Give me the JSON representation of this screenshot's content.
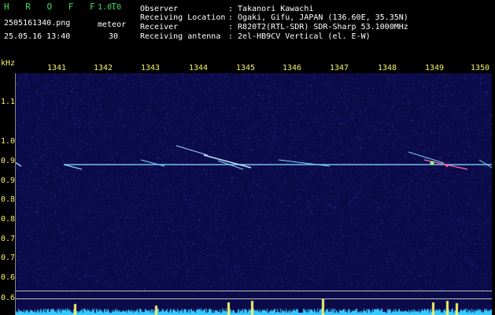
{
  "app": {
    "name": "H R O F F T",
    "version": "1.0.0"
  },
  "file": {
    "name": "2505161340.png",
    "datetime": "25.05.16 13:40"
  },
  "detection": {
    "label": "meteor",
    "count": "30"
  },
  "info": {
    "observer_label": "Observer",
    "observer_value": ": Takanori Kawachi",
    "location_label": "Receiving Location",
    "location_value": ": Ogaki, Gifu, JAPAN (136.60E, 35.35N)",
    "receiver_label": "Receiver",
    "receiver_value": ": R820T2(RTL-SDR) SDR-Sharp 53.1000MHz",
    "antenna_label": "Receiving antenna",
    "antenna_value": ": 2el-HB9CV Vertical (el. E-W)"
  },
  "axis": {
    "unit": "kHz",
    "time_ticks": [
      "1341",
      "1342",
      "1343",
      "1344",
      "1345",
      "1346",
      "1347",
      "1348",
      "1349",
      "1350"
    ],
    "freq_ticks": [
      "1.1",
      "1.0",
      "0.95",
      "0.9",
      "0.85",
      "0.8",
      "0.75",
      "0.7",
      "0.65",
      "0.6"
    ]
  },
  "colors": {
    "background": "#000000",
    "plot_bg": "#0b0b4a",
    "green_text": "#3ee05a",
    "yellow_text": "#f4f06a",
    "carrier": "#7fd6ff",
    "histogram": "#37c8ff",
    "spike": "#f4f06a"
  }
}
